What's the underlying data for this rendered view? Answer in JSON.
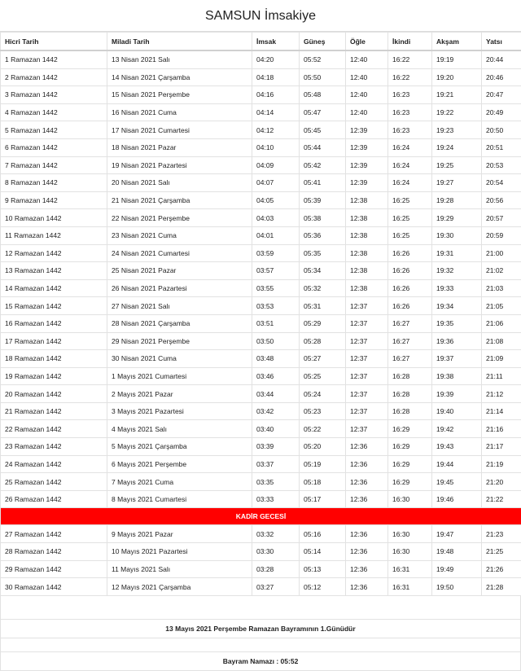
{
  "title": "SAMSUN İmsakiye",
  "headers": [
    "Hicri Tarih",
    "Miladi Tarih",
    "İmsak",
    "Güneş",
    "Öğle",
    "İkindi",
    "Akşam",
    "Yatsı"
  ],
  "rows": [
    [
      "1 Ramazan 1442",
      "13 Nisan 2021 Salı",
      "04:20",
      "05:52",
      "12:40",
      "16:22",
      "19:19",
      "20:44"
    ],
    [
      "2 Ramazan 1442",
      "14 Nisan 2021 Çarşamba",
      "04:18",
      "05:50",
      "12:40",
      "16:22",
      "19:20",
      "20:46"
    ],
    [
      "3 Ramazan 1442",
      "15 Nisan 2021 Perşembe",
      "04:16",
      "05:48",
      "12:40",
      "16:23",
      "19:21",
      "20:47"
    ],
    [
      "4 Ramazan 1442",
      "16 Nisan 2021 Cuma",
      "04:14",
      "05:47",
      "12:40",
      "16:23",
      "19:22",
      "20:49"
    ],
    [
      "5 Ramazan 1442",
      "17 Nisan 2021 Cumartesi",
      "04:12",
      "05:45",
      "12:39",
      "16:23",
      "19:23",
      "20:50"
    ],
    [
      "6 Ramazan 1442",
      "18 Nisan 2021 Pazar",
      "04:10",
      "05:44",
      "12:39",
      "16:24",
      "19:24",
      "20:51"
    ],
    [
      "7 Ramazan 1442",
      "19 Nisan 2021 Pazartesi",
      "04:09",
      "05:42",
      "12:39",
      "16:24",
      "19:25",
      "20:53"
    ],
    [
      "8 Ramazan 1442",
      "20 Nisan 2021 Salı",
      "04:07",
      "05:41",
      "12:39",
      "16:24",
      "19:27",
      "20:54"
    ],
    [
      "9 Ramazan 1442",
      "21 Nisan 2021 Çarşamba",
      "04:05",
      "05:39",
      "12:38",
      "16:25",
      "19:28",
      "20:56"
    ],
    [
      "10 Ramazan 1442",
      "22 Nisan 2021 Perşembe",
      "04:03",
      "05:38",
      "12:38",
      "16:25",
      "19:29",
      "20:57"
    ],
    [
      "11 Ramazan 1442",
      "23 Nisan 2021 Cuma",
      "04:01",
      "05:36",
      "12:38",
      "16:25",
      "19:30",
      "20:59"
    ],
    [
      "12 Ramazan 1442",
      "24 Nisan 2021 Cumartesi",
      "03:59",
      "05:35",
      "12:38",
      "16:26",
      "19:31",
      "21:00"
    ],
    [
      "13 Ramazan 1442",
      "25 Nisan 2021 Pazar",
      "03:57",
      "05:34",
      "12:38",
      "16:26",
      "19:32",
      "21:02"
    ],
    [
      "14 Ramazan 1442",
      "26 Nisan 2021 Pazartesi",
      "03:55",
      "05:32",
      "12:38",
      "16:26",
      "19:33",
      "21:03"
    ],
    [
      "15 Ramazan 1442",
      "27 Nisan 2021 Salı",
      "03:53",
      "05:31",
      "12:37",
      "16:26",
      "19:34",
      "21:05"
    ],
    [
      "16 Ramazan 1442",
      "28 Nisan 2021 Çarşamba",
      "03:51",
      "05:29",
      "12:37",
      "16:27",
      "19:35",
      "21:06"
    ],
    [
      "17 Ramazan 1442",
      "29 Nisan 2021 Perşembe",
      "03:50",
      "05:28",
      "12:37",
      "16:27",
      "19:36",
      "21:08"
    ],
    [
      "18 Ramazan 1442",
      "30 Nisan 2021 Cuma",
      "03:48",
      "05:27",
      "12:37",
      "16:27",
      "19:37",
      "21:09"
    ],
    [
      "19 Ramazan 1442",
      "1 Mayıs 2021 Cumartesi",
      "03:46",
      "05:25",
      "12:37",
      "16:28",
      "19:38",
      "21:11"
    ],
    [
      "20 Ramazan 1442",
      "2 Mayıs 2021 Pazar",
      "03:44",
      "05:24",
      "12:37",
      "16:28",
      "19:39",
      "21:12"
    ],
    [
      "21 Ramazan 1442",
      "3 Mayıs 2021 Pazartesi",
      "03:42",
      "05:23",
      "12:37",
      "16:28",
      "19:40",
      "21:14"
    ],
    [
      "22 Ramazan 1442",
      "4 Mayıs 2021 Salı",
      "03:40",
      "05:22",
      "12:37",
      "16:29",
      "19:42",
      "21:16"
    ],
    [
      "23 Ramazan 1442",
      "5 Mayıs 2021 Çarşamba",
      "03:39",
      "05:20",
      "12:36",
      "16:29",
      "19:43",
      "21:17"
    ],
    [
      "24 Ramazan 1442",
      "6 Mayıs 2021 Perşembe",
      "03:37",
      "05:19",
      "12:36",
      "16:29",
      "19:44",
      "21:19"
    ],
    [
      "25 Ramazan 1442",
      "7 Mayıs 2021 Cuma",
      "03:35",
      "05:18",
      "12:36",
      "16:29",
      "19:45",
      "21:20"
    ],
    [
      "26 Ramazan 1442",
      "8 Mayıs 2021 Cumartesi",
      "03:33",
      "05:17",
      "12:36",
      "16:30",
      "19:46",
      "21:22"
    ],
    [
      "KADİR GECESİ"
    ],
    [
      "27 Ramazan 1442",
      "9 Mayıs 2021 Pazar",
      "03:32",
      "05:16",
      "12:36",
      "16:30",
      "19:47",
      "21:23"
    ],
    [
      "28 Ramazan 1442",
      "10 Mayıs 2021 Pazartesi",
      "03:30",
      "05:14",
      "12:36",
      "16:30",
      "19:48",
      "21:25"
    ],
    [
      "29 Ramazan 1442",
      "11 Mayıs 2021 Salı",
      "03:28",
      "05:13",
      "12:36",
      "16:31",
      "19:49",
      "21:26"
    ],
    [
      "30 Ramazan 1442",
      "12 Mayıs 2021 Çarşamba",
      "03:27",
      "05:12",
      "12:36",
      "16:31",
      "19:50",
      "21:28"
    ]
  ],
  "footer": {
    "bayram_note": "13 Mayıs 2021 Perşembe Ramazan Bayramının 1.Günüdür",
    "bayram_namazi": "Bayram Namazı : 05:52"
  },
  "colors": {
    "special_row_bg": "#ff0000",
    "special_row_text": "#ffffff"
  }
}
